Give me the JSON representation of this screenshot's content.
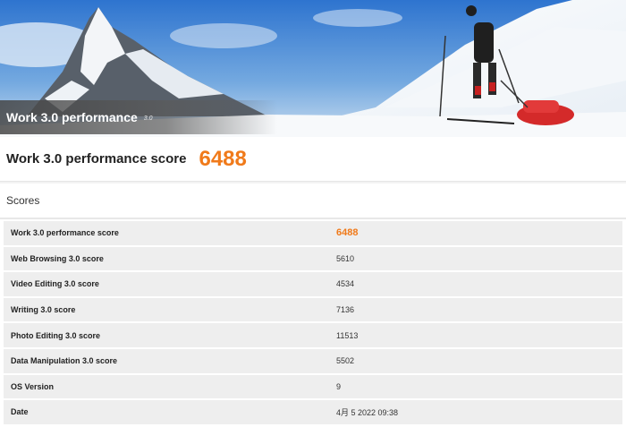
{
  "banner": {
    "title": "Work 3.0 performance",
    "version": "3.0"
  },
  "summary": {
    "label": "Work 3.0 performance score",
    "score": "6488"
  },
  "scores": {
    "title": "Scores",
    "rows": [
      {
        "name": "Work 3.0 performance score",
        "value": "6488"
      },
      {
        "name": "Web Browsing 3.0 score",
        "value": "5610"
      },
      {
        "name": "Video Editing 3.0 score",
        "value": "4534"
      },
      {
        "name": "Writing 3.0 score",
        "value": "7136"
      },
      {
        "name": "Photo Editing 3.0 score",
        "value": "11513"
      },
      {
        "name": "Data Manipulation 3.0 score",
        "value": "5502"
      },
      {
        "name": "OS Version",
        "value": "9"
      },
      {
        "name": "Date",
        "value": "4月 5 2022 09:38"
      }
    ]
  },
  "colors": {
    "accent": "#f07a1a",
    "row_bg": "#eeeeee",
    "sky": "#3f86d6"
  }
}
